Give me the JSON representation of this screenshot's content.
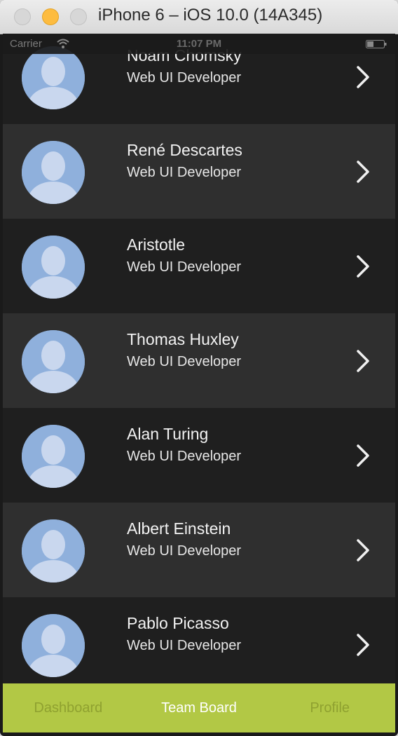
{
  "window": {
    "title": "iPhone 6 – iOS 10.0 (14A345)"
  },
  "statusbar": {
    "carrier": "Carrier",
    "time": "11:07 PM"
  },
  "people": [
    {
      "name": "Noam Chomsky",
      "role": "Web UI Developer"
    },
    {
      "name": "René Descartes",
      "role": "Web UI Developer"
    },
    {
      "name": "Aristotle",
      "role": "Web UI Developer"
    },
    {
      "name": "Thomas Huxley",
      "role": "Web UI Developer"
    },
    {
      "name": "Alan Turing",
      "role": "Web UI Developer"
    },
    {
      "name": "Albert Einstein",
      "role": "Web UI Developer"
    },
    {
      "name": "Pablo Picasso",
      "role": "Web UI Developer"
    }
  ],
  "tabs": [
    {
      "label": "Dashboard",
      "active": false
    },
    {
      "label": "Team Board",
      "active": true
    },
    {
      "label": "Profile",
      "active": false
    }
  ],
  "colors": {
    "accent": "#b2c845",
    "row_dark": "#1f1f1f",
    "row_light": "#2f2f2f",
    "avatar_bg": "#8fb0dc"
  },
  "icons": {
    "avatar": "person-silhouette-icon",
    "chevron": "chevron-right-icon"
  }
}
